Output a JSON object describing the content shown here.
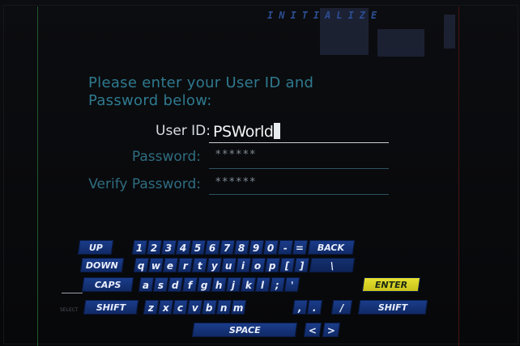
{
  "header": {
    "logo_text": "INITIALIZE"
  },
  "login": {
    "prompt_line1": "Please enter your User ID and",
    "prompt_line2": "Password below:",
    "userid_label": "User ID:",
    "userid_value": "PSWorld",
    "password_label": "Password:",
    "password_value": "******",
    "verify_label": "Verify Password:",
    "verify_value": "******"
  },
  "keyboard": {
    "row1": [
      "UP",
      "1",
      "2",
      "3",
      "4",
      "5",
      "6",
      "7",
      "8",
      "9",
      "0",
      "-",
      "=",
      "BACK"
    ],
    "row2": [
      "DOWN",
      "q",
      "w",
      "e",
      "r",
      "t",
      "y",
      "u",
      "i",
      "o",
      "p",
      "[",
      "]",
      "\\"
    ],
    "row3": [
      "CAPS",
      "a",
      "s",
      "d",
      "f",
      "g",
      "h",
      "j",
      "k",
      "l",
      ";",
      "'",
      "ENTER"
    ],
    "row4": [
      "SHIFT",
      "z",
      "x",
      "c",
      "v",
      "b",
      "n",
      "m",
      ",",
      ".",
      "/",
      "SHIFT"
    ],
    "row5": [
      "SPACE",
      "<",
      ">"
    ],
    "side_label": "SELECT",
    "highlight_color": "#e7e132",
    "key_color": "#1a3c8a"
  }
}
